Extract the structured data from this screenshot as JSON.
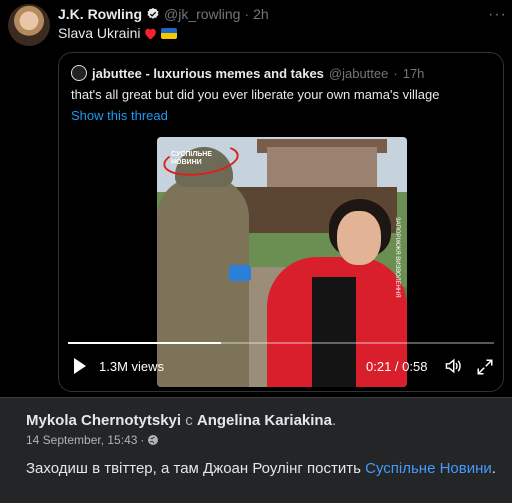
{
  "tweet": {
    "author_name": "J.K. Rowling",
    "handle": "@jk_rowling",
    "separator": "·",
    "time": "2h",
    "text": "Slava Ukraini",
    "more_label": "···"
  },
  "quote": {
    "author_name": "jabuttee - luxurious memes and takes",
    "handle": "@jabuttee",
    "separator": "·",
    "time": "17h",
    "text": "that's all great but did you ever liberate your own mama's village",
    "show_thread": "Show this thread"
  },
  "video": {
    "watermark": "СУСПІЛЬНЕ НОВИНИ",
    "side_caption": "ЗАПОРІЖЖЯ ВИЗВОЛЕННЯ",
    "views": "1.3M views",
    "time_display": "0:21 / 0:58",
    "progress_fraction": 0.36
  },
  "facebook": {
    "author": "Mykola Chernotytskyi",
    "with_word": "с",
    "tagged": "Angelina Kariakina",
    "period": ".",
    "date": "14 September, 15:43",
    "date_sep": "·",
    "text": "Заходиш в твіттер, а там Джоан Роулінг постить ",
    "link_text": "Суспільне Новини",
    "text_end": "."
  },
  "colors": {
    "accent_blue": "#1d9bf0",
    "fb_link": "#4599ff",
    "heart": "#f4212e",
    "flag_blue": "#1d66c9",
    "flag_yellow": "#f5c800"
  }
}
